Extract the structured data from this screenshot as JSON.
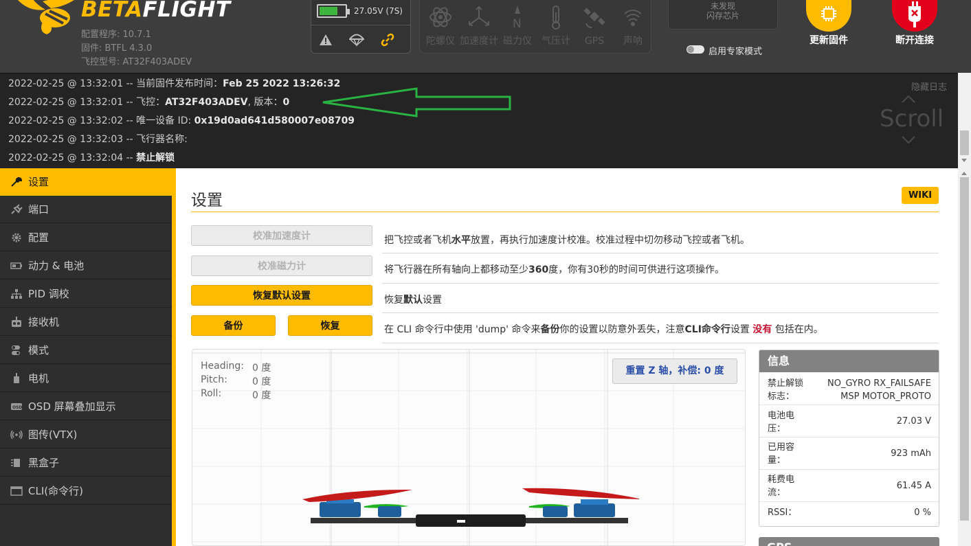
{
  "header": {
    "brand_beta": "BETA",
    "brand_flight": "FLIGHT",
    "configurator": "配置程序: 10.7.1",
    "firmware": "固件: BTFL 4.3.0",
    "board": "飞控型号: AT32F403ADEV",
    "battery_text": "27.05V (7S)",
    "sensors": [
      {
        "icon": "gyro-icon",
        "label": "陀螺仪"
      },
      {
        "icon": "accelerometer-icon",
        "label": "加速度计"
      },
      {
        "icon": "magnetometer-icon",
        "label": "磁力仪"
      },
      {
        "icon": "barometer-icon",
        "label": "气压计"
      },
      {
        "icon": "gps-icon",
        "label": "GPS"
      },
      {
        "icon": "sonar-icon",
        "label": "声呐"
      }
    ],
    "flash_line1": "未发现",
    "flash_line2": "闪存芯片",
    "expert_mode": "启用专家模式",
    "update_firmware": "更新固件",
    "disconnect": "断开连接",
    "colors": {
      "accent": "#ffbb00",
      "disconnect": "#e2001a"
    }
  },
  "log": {
    "hide_label": "隐藏日志",
    "scroll_label": "Scroll",
    "lines": [
      {
        "prefix": "2022-02-25 @ 13:32:01 -- 当前固件发布时间：",
        "bold": "Feb 25 2022 13:26:32",
        "suffix": ""
      },
      {
        "prefix": "2022-02-25 @ 13:32:01 -- 飞控：",
        "bold": "AT32F403ADEV",
        "suffix": ", 版本：",
        "bold2": "0"
      },
      {
        "prefix": "2022-02-25 @ 13:32:02 -- 唯一设备 ID: ",
        "bold": "0x19d0ad641d580007e08709",
        "suffix": ""
      },
      {
        "prefix": "2022-02-25 @ 13:32:03 -- 飞行器名称:",
        "bold": "",
        "suffix": ""
      },
      {
        "prefix": "2022-02-25 @ 13:32:04 -- ",
        "bold": "禁止解锁",
        "suffix": ""
      }
    ]
  },
  "sidebar": {
    "items": [
      {
        "icon": "wrench-icon",
        "label": "设置"
      },
      {
        "icon": "plug-icon",
        "label": "端口"
      },
      {
        "icon": "gear-icon",
        "label": "配置"
      },
      {
        "icon": "battery-icon",
        "label": "动力 & 电池"
      },
      {
        "icon": "sitemap-icon",
        "label": "PID 调校"
      },
      {
        "icon": "receiver-icon",
        "label": "接收机"
      },
      {
        "icon": "toggle-icon",
        "label": "模式"
      },
      {
        "icon": "motor-icon",
        "label": "电机"
      },
      {
        "icon": "osd-icon",
        "label": "OSD 屏幕叠加显示"
      },
      {
        "icon": "vtx-icon",
        "label": "图传(VTX)"
      },
      {
        "icon": "blackbox-icon",
        "label": "黑盒子"
      },
      {
        "icon": "terminal-icon",
        "label": "CLI(命令行)"
      }
    ]
  },
  "main": {
    "title": "设置",
    "wiki": "WIKI",
    "calibrate_acc": "校准加速度计",
    "calibrate_mag": "校准磁力计",
    "reset_defaults": "恢复默认设置",
    "backup": "备份",
    "restore": "恢复",
    "desc_acc": {
      "a": "把飞控或者飞机",
      "b": "水平",
      "c": "放置，再执行加速度计校准。校准过程中切勿移动飞控或者飞机。"
    },
    "desc_mag": {
      "a": "将飞行器在所有轴向上都移动至少",
      "b": "360",
      "c": "度，你有30秒的时间可供进行这项操作。"
    },
    "desc_reset": {
      "a": "恢复",
      "b": "默认",
      "c": "设置"
    },
    "desc_backup": {
      "a": "在 CLI 命令行中使用 'dump' 命令来",
      "b": "备份",
      "c": "你的设置以防意外丢失，注意",
      "d": "CLI命令行",
      "e": "设置 ",
      "f": "没有",
      "g": " 包括在内。"
    },
    "attitude": {
      "heading_label": "Heading:",
      "heading_value": "0 度",
      "pitch_label": "Pitch:",
      "pitch_value": "0 度",
      "roll_label": "Roll:",
      "roll_value": "0 度"
    },
    "reset_z": "重置 Z 轴，补偿: 0 度"
  },
  "info": {
    "title": "信息",
    "arming_key": "禁止解锁标志：",
    "arming_val1": "NO_GYRO  RX_FAILSAFE",
    "arming_val2": "MSP  MOTOR_PROTO",
    "battery_key": "电池电压：",
    "battery_val": "27.03 V",
    "capacity_key": "已用容量：",
    "capacity_val": "923 mAh",
    "current_key": "耗费电流：",
    "current_val": "61.45 A",
    "rssi_key": "RSSI：",
    "rssi_val": "0 %",
    "gps_title": "GPS"
  }
}
